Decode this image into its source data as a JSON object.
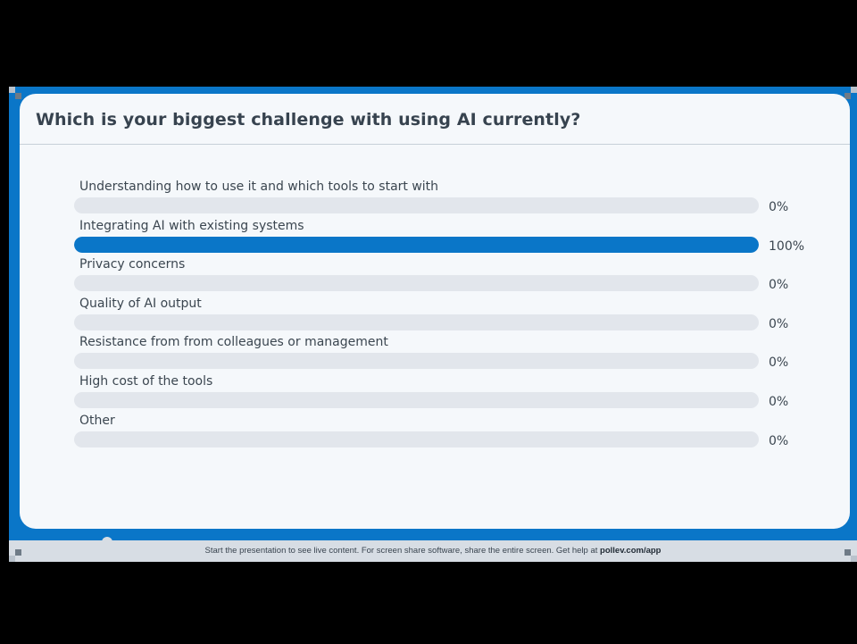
{
  "poll": {
    "question": "Which is your biggest challenge with using AI currently?",
    "options": [
      {
        "label": "Understanding how to use it and which tools to start with",
        "percent_label": "0%",
        "fraction": 0.0
      },
      {
        "label": "Integrating AI with existing systems",
        "percent_label": "100%",
        "fraction": 1.0
      },
      {
        "label": "Privacy concerns",
        "percent_label": "0%",
        "fraction": 0.0
      },
      {
        "label": "Quality of AI output",
        "percent_label": "0%",
        "fraction": 0.0
      },
      {
        "label": "Resistance from from colleagues or management",
        "percent_label": "0%",
        "fraction": 0.0
      },
      {
        "label": "High cost of the tools",
        "percent_label": "0%",
        "fraction": 0.0
      },
      {
        "label": "Other",
        "percent_label": "0%",
        "fraction": 0.0
      }
    ]
  },
  "footer": {
    "message": "Start the presentation to see live content. For screen share software, share the entire screen. Get help at ",
    "link": "pollev.com/app"
  },
  "colors": {
    "accent": "#0a76c8",
    "track": "#e2e6ec",
    "card": "#f5f8fb"
  }
}
